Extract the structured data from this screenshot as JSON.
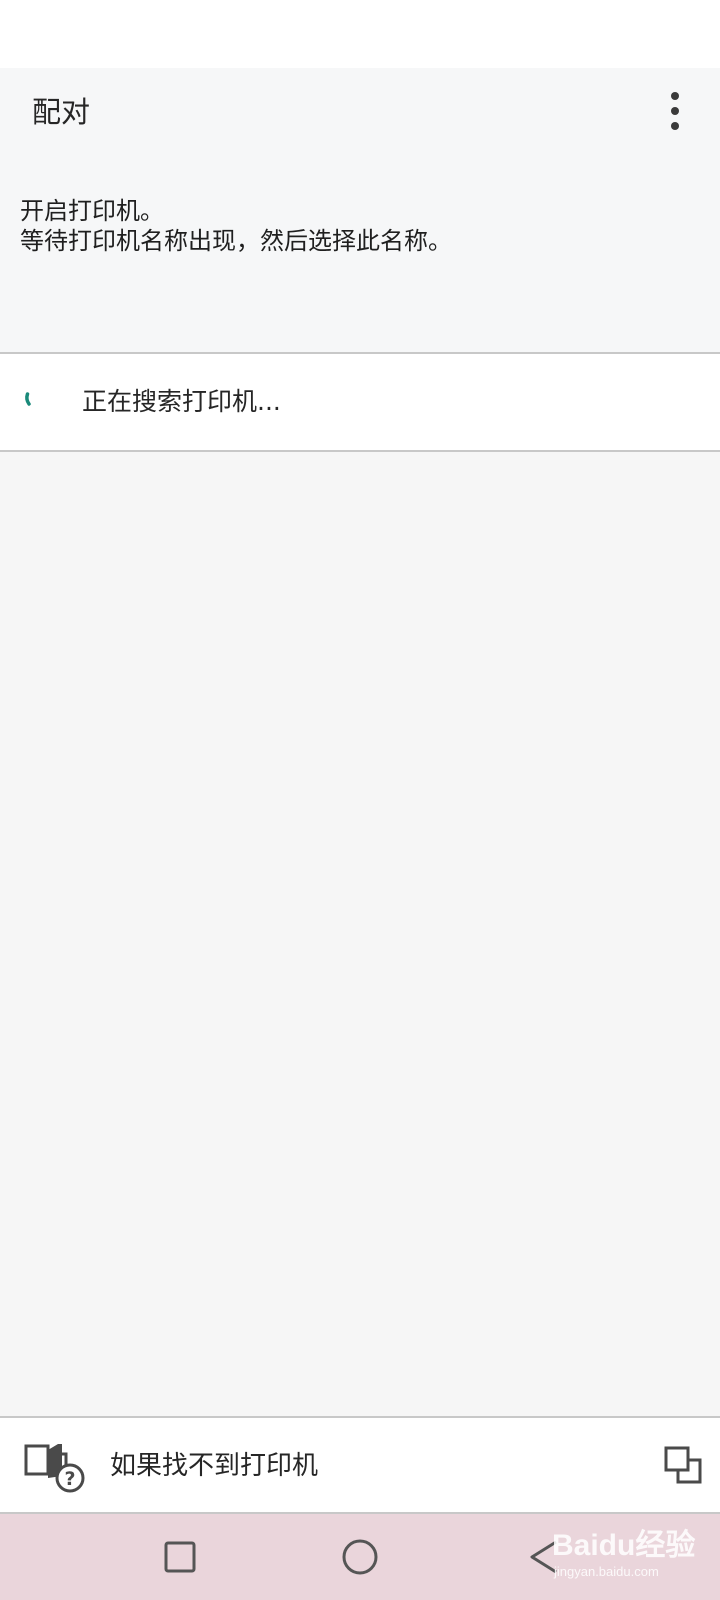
{
  "app_bar": {
    "title": "配对",
    "overflow_icon": "more-vert-icon"
  },
  "instructions": {
    "line1": "开启打印机。",
    "line2": "等待打印机名称出现，然后选择此名称。"
  },
  "search_status": {
    "text": "正在搜索打印机...",
    "spinner_color": "#1a8a7a"
  },
  "footer": {
    "help_label": "如果找不到打印机",
    "help_icon": "printer-help-icon",
    "external_icon": "open-external-icon"
  },
  "nav_bar": {
    "recent_icon": "square-recents-icon",
    "home_icon": "circle-home-icon",
    "back_icon": "triangle-back-icon"
  },
  "watermark": {
    "brand": "Baidu经验",
    "url": "jingyan.baidu.com"
  },
  "colors": {
    "header_bg": "#f6f7f8",
    "divider": "#c8c8c8",
    "nav_bar_bg": "#ead5db"
  }
}
